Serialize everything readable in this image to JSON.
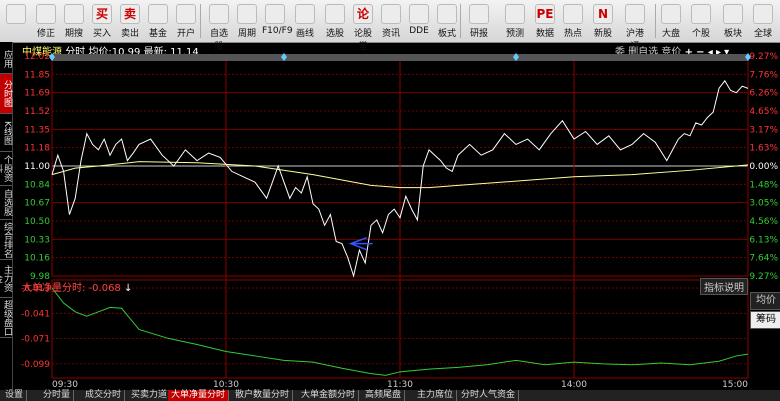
{
  "toolbar": {
    "buttons": [
      {
        "label": "",
        "icon": "back-arrow-icon"
      },
      {
        "label": "修正",
        "icon": "up-down-arrows-icon"
      },
      {
        "label": "期搜",
        "icon": "clock-icon"
      },
      {
        "label": "买入",
        "icon": "buy-icon",
        "glyph": "买"
      },
      {
        "label": "卖出",
        "icon": "sell-icon",
        "glyph": "卖"
      },
      {
        "label": "基金",
        "icon": "fund-icon"
      },
      {
        "label": "开户",
        "icon": "lock-icon"
      },
      {
        "label": "自选股",
        "icon": "star-icon"
      },
      {
        "label": "周期",
        "icon": "period-icon"
      },
      {
        "label": "F10/F9",
        "icon": "f10-icon"
      },
      {
        "label": "画线",
        "icon": "pen-icon"
      },
      {
        "label": "选股",
        "icon": "screen-icon"
      },
      {
        "label": "论股堂",
        "icon": "discuss-icon",
        "glyph": "论"
      },
      {
        "label": "资讯",
        "icon": "news-icon"
      },
      {
        "label": "DDE",
        "icon": "dde-icon"
      },
      {
        "label": "板式",
        "icon": "layout-icon"
      },
      {
        "label": "研报",
        "icon": "report-icon"
      },
      {
        "label": "预测",
        "icon": "forecast-icon"
      },
      {
        "label": "数据",
        "icon": "pe-icon",
        "glyph": "PE"
      },
      {
        "label": "热点",
        "icon": "fire-icon"
      },
      {
        "label": "新股",
        "icon": "new-stock-icon",
        "glyph": "N"
      },
      {
        "label": "沪港通",
        "icon": "hk-connect-icon"
      },
      {
        "label": "大盘",
        "icon": "market-icon"
      },
      {
        "label": "个股",
        "icon": "stock-icon"
      },
      {
        "label": "板块",
        "icon": "sector-icon"
      },
      {
        "label": "全球",
        "icon": "globe-icon"
      }
    ]
  },
  "stock": {
    "name": "中煤能源",
    "mode": "分时",
    "avg_label": "均价:",
    "avg_value": "10.99",
    "last_label": "最新:",
    "last_value": "11.14"
  },
  "controls": {
    "labels": [
      "委",
      "删自选",
      "竞价"
    ],
    "icons": [
      "plus-icon",
      "minus-icon",
      "left-arrow-icon",
      "right-arrow-icon",
      "menu-down-icon"
    ]
  },
  "left_tabs": [
    {
      "label": "应用",
      "active": false
    },
    {
      "label": "分时图",
      "active": true
    },
    {
      "label": "K线图",
      "active": false
    },
    {
      "label": "个股资料",
      "active": false
    },
    {
      "label": "自选股",
      "active": false
    },
    {
      "label": "综合排名",
      "active": false
    },
    {
      "label": "主力资金",
      "active": false
    },
    {
      "label": "超级盘口",
      "active": false
    }
  ],
  "right_tabs": [
    {
      "label": "均价",
      "active": false
    },
    {
      "label": "筹码",
      "active": true
    }
  ],
  "indicator": {
    "title": "大单净量分时:",
    "value": "-0.068",
    "arrow": "↓",
    "help_label": "指标说明"
  },
  "bottom_tabs": [
    {
      "label": "设置",
      "active": false
    },
    {
      "label": "分时量",
      "active": false
    },
    {
      "label": "成交分时",
      "active": false
    },
    {
      "label": "买卖力道",
      "active": false
    },
    {
      "label": "大单净量分时",
      "active": true
    },
    {
      "label": "散户数量分时",
      "active": false
    },
    {
      "label": "大单金额分时",
      "active": false
    },
    {
      "label": "高频尾盘",
      "active": false
    },
    {
      "label": "主力席位",
      "active": false
    },
    {
      "label": "分时人气资金",
      "active": false
    }
  ],
  "chart_data": {
    "type": "line",
    "colors": {
      "price": "#ffffff",
      "avg": "#ffff99",
      "indicator": "#33cc33",
      "grid": "#8b0000",
      "up": "#ff3333",
      "down": "#33cc33",
      "base": "#ffffff"
    },
    "price_axis": {
      "ylim": [
        9.98,
        12.02
      ],
      "ticks": [
        "12.02",
        "11.85",
        "11.69",
        "11.52",
        "11.35",
        "11.18",
        "11.00",
        "10.84",
        "10.67",
        "10.50",
        "10.33",
        "10.16",
        "9.98"
      ],
      "pct_ticks": [
        "9.27%",
        "7.76%",
        "6.26%",
        "4.65%",
        "3.17%",
        "1.63%",
        "0.00%",
        "1.48%",
        "3.05%",
        "4.56%",
        "6.13%",
        "7.64%",
        "9.27%"
      ],
      "base_price": 11.0
    },
    "indicator_axis": {
      "ylim": [
        -0.115,
        -0.013
      ],
      "ticks": [
        "-0.013",
        "-0.041",
        "-0.071",
        "-0.099"
      ]
    },
    "x_ticks": [
      "09:30",
      "10:30",
      "11:30",
      "14:00",
      "15:00"
    ],
    "x_range": [
      0,
      240
    ],
    "price_series": {
      "name": "价格",
      "x": [
        0,
        2,
        4,
        6,
        8,
        10,
        12,
        14,
        16,
        18,
        20,
        22,
        24,
        26,
        28,
        30,
        34,
        38,
        42,
        46,
        50,
        54,
        58,
        62,
        66,
        70,
        74,
        78,
        80,
        82,
        84,
        86,
        88,
        90,
        92,
        94,
        96,
        98,
        100,
        102,
        104,
        106,
        108,
        110,
        112,
        114,
        116,
        118,
        120,
        122,
        124,
        126,
        128,
        130,
        132,
        134,
        136,
        138,
        140,
        144,
        148,
        152,
        156,
        160,
        164,
        168,
        172,
        176,
        180,
        184,
        188,
        192,
        196,
        200,
        204,
        208,
        212,
        216,
        218,
        220,
        222,
        224,
        226,
        228,
        230,
        232,
        234,
        236,
        238,
        240
      ],
      "y": [
        10.92,
        11.1,
        10.95,
        10.55,
        10.7,
        11.05,
        11.3,
        11.2,
        11.15,
        11.25,
        11.1,
        11.2,
        11.25,
        11.05,
        11.12,
        11.2,
        11.25,
        11.1,
        11.0,
        11.15,
        11.05,
        11.12,
        11.08,
        10.95,
        10.9,
        10.85,
        10.7,
        11.0,
        10.85,
        10.7,
        10.8,
        10.75,
        10.9,
        10.65,
        10.6,
        10.45,
        10.55,
        10.3,
        10.28,
        10.15,
        9.98,
        10.22,
        10.1,
        10.45,
        10.5,
        10.38,
        10.55,
        10.6,
        10.52,
        10.72,
        10.6,
        10.5,
        11.0,
        11.15,
        11.1,
        11.05,
        10.98,
        10.95,
        11.1,
        11.2,
        11.1,
        11.15,
        11.3,
        11.2,
        11.25,
        11.15,
        11.3,
        11.42,
        11.25,
        11.32,
        11.2,
        11.28,
        11.15,
        11.2,
        11.3,
        11.22,
        11.05,
        11.25,
        11.3,
        11.28,
        11.4,
        11.38,
        11.45,
        11.5,
        11.72,
        11.79,
        11.7,
        11.68,
        11.74,
        11.72
      ]
    },
    "avg_series": {
      "name": "均价",
      "x": [
        0,
        8,
        16,
        30,
        50,
        70,
        90,
        100,
        110,
        120,
        130,
        140,
        160,
        180,
        200,
        220,
        240
      ],
      "y": [
        10.92,
        10.98,
        11.0,
        11.04,
        11.03,
        11.0,
        10.92,
        10.87,
        10.82,
        10.8,
        10.8,
        10.82,
        10.86,
        10.9,
        10.92,
        10.96,
        11.01
      ]
    },
    "indicator_series": {
      "name": "大单净量分时",
      "x": [
        0,
        4,
        8,
        12,
        16,
        20,
        24,
        30,
        40,
        50,
        60,
        70,
        80,
        90,
        100,
        110,
        115,
        120,
        130,
        140,
        150,
        160,
        170,
        180,
        190,
        200,
        210,
        220,
        230,
        236,
        240
      ],
      "y": [
        -0.013,
        -0.03,
        -0.04,
        -0.045,
        -0.04,
        -0.035,
        -0.036,
        -0.06,
        -0.07,
        -0.077,
        -0.085,
        -0.09,
        -0.095,
        -0.097,
        -0.104,
        -0.11,
        -0.112,
        -0.108,
        -0.105,
        -0.103,
        -0.1,
        -0.095,
        -0.1,
        -0.097,
        -0.099,
        -0.1,
        -0.098,
        -0.1,
        -0.096,
        -0.09,
        -0.088
      ]
    },
    "markers": {
      "arrow_annotation_x": 103,
      "arrow_annotation_y": 10.28
    }
  }
}
